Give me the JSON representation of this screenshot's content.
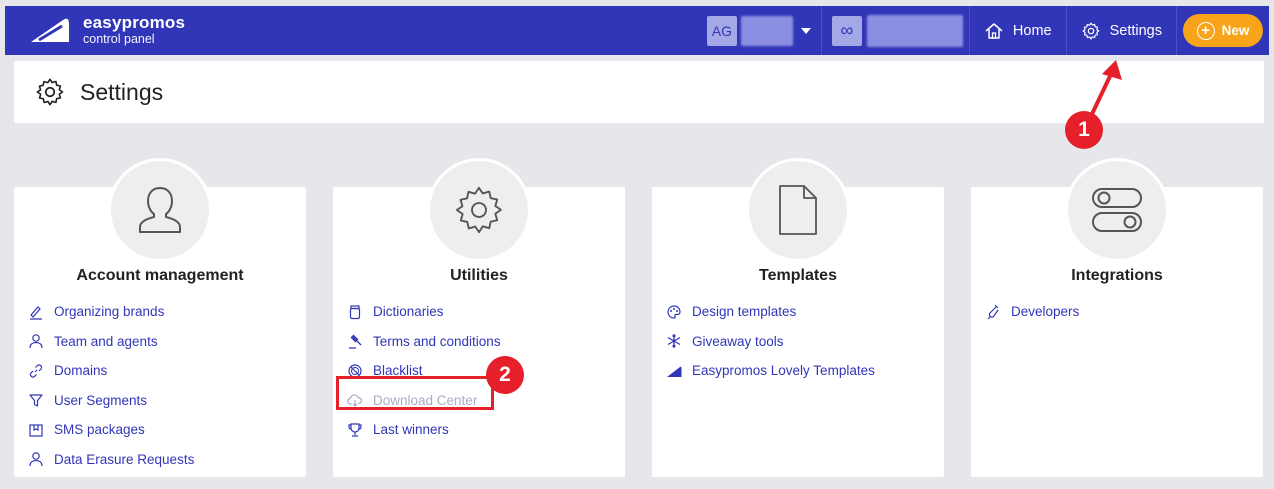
{
  "brand": {
    "name": "easypromos",
    "subtitle": "control panel"
  },
  "account": {
    "initials": "AG",
    "plan_symbol": "∞"
  },
  "nav": {
    "home": "Home",
    "settings": "Settings",
    "new": "New"
  },
  "page": {
    "title": "Settings"
  },
  "cards": [
    {
      "title": "Account management",
      "icon": "user-icon",
      "items": [
        {
          "label": "Organizing brands",
          "icon": "signature-icon"
        },
        {
          "label": "Team and agents",
          "icon": "user-icon"
        },
        {
          "label": "Domains",
          "icon": "link-icon"
        },
        {
          "label": "User Segments",
          "icon": "filter-icon"
        },
        {
          "label": "SMS packages",
          "icon": "package-icon"
        },
        {
          "label": "Data Erasure Requests",
          "icon": "user-icon"
        }
      ]
    },
    {
      "title": "Utilities",
      "icon": "gear-icon",
      "items": [
        {
          "label": "Dictionaries",
          "icon": "jar-icon"
        },
        {
          "label": "Terms and conditions",
          "icon": "gavel-icon"
        },
        {
          "label": "Blacklist",
          "icon": "ban-icon"
        },
        {
          "label": "Download Center",
          "icon": "cloud-download-icon",
          "disabled": true
        },
        {
          "label": "Last winners",
          "icon": "trophy-icon"
        }
      ]
    },
    {
      "title": "Templates",
      "icon": "document-icon",
      "items": [
        {
          "label": "Design templates",
          "icon": "palette-icon"
        },
        {
          "label": "Giveaway tools",
          "icon": "snowflake-icon"
        },
        {
          "label": "Easypromos Lovely Templates",
          "icon": "triangle-icon"
        }
      ]
    },
    {
      "title": "Integrations",
      "icon": "toggle-icon",
      "items": [
        {
          "label": "Developers",
          "icon": "flask-icon"
        }
      ]
    }
  ],
  "annotations": {
    "badge_1": "1",
    "badge_2": "2"
  },
  "colors": {
    "primary": "#3136b8",
    "accent": "#f7a41a",
    "annotation": "#e5202a"
  }
}
